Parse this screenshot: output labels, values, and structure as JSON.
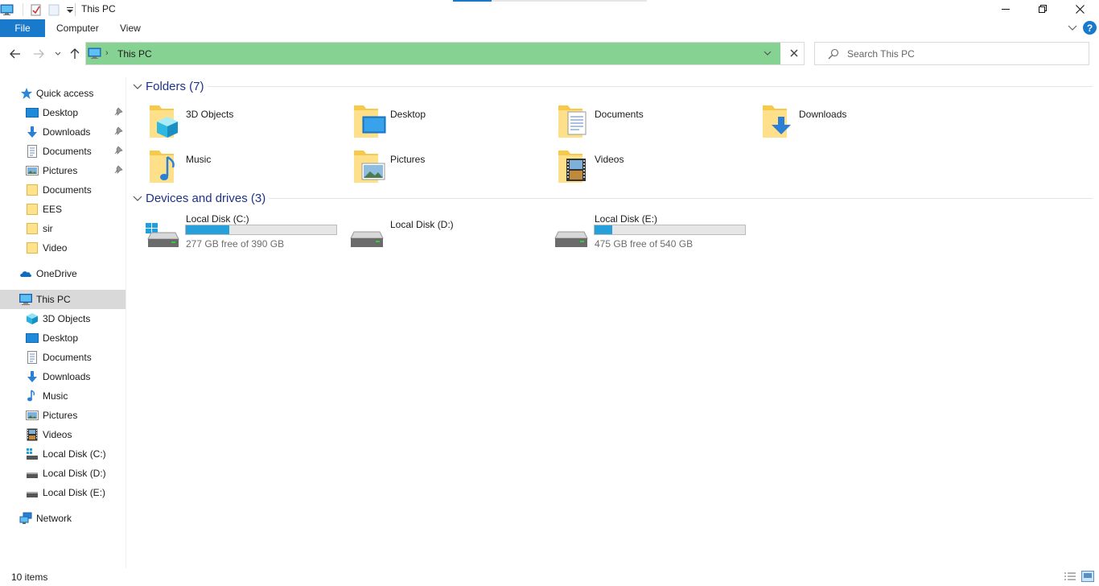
{
  "window": {
    "title": "This PC"
  },
  "ribbon": {
    "file": "File",
    "tabs": [
      "Computer",
      "View"
    ]
  },
  "address": {
    "path": "This PC"
  },
  "search": {
    "placeholder": "Search This PC"
  },
  "sidebar": {
    "quick_access": "Quick access",
    "quick_items": [
      "Desktop",
      "Downloads",
      "Documents",
      "Pictures",
      "Documents",
      "EES",
      "sir",
      "Video"
    ],
    "onedrive": "OneDrive",
    "this_pc": "This PC",
    "pc_items": [
      "3D Objects",
      "Desktop",
      "Documents",
      "Downloads",
      "Music",
      "Pictures",
      "Videos",
      "Local Disk (C:)",
      "Local Disk (D:)",
      "Local Disk (E:)"
    ],
    "network": "Network"
  },
  "content": {
    "folders_header": "Folders (7)",
    "folders": [
      "3D Objects",
      "Desktop",
      "Documents",
      "Downloads",
      "Music",
      "Pictures",
      "Videos"
    ],
    "drives_header": "Devices and drives (3)",
    "drives": [
      {
        "name": "Local Disk (C:)",
        "free_text": "277 GB free of 390 GB",
        "used_fraction": 0.29
      },
      {
        "name": "Local Disk (D:)"
      },
      {
        "name": "Local Disk (E:)",
        "free_text": "475 GB free of 540 GB",
        "used_fraction": 0.12
      }
    ]
  },
  "status": {
    "item_count": "10 items"
  },
  "colors": {
    "accent": "#1979ca",
    "address_highlight": "#86d293",
    "usage_bar": "#26a0da",
    "group_header": "#1e3287"
  }
}
